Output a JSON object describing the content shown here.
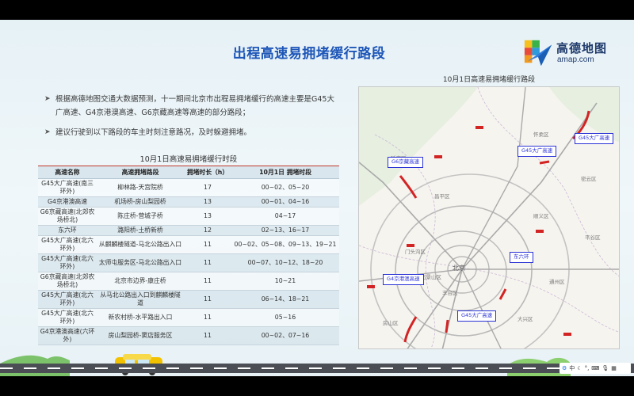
{
  "title": "出程高速易拥堵缓行路段",
  "logo": {
    "name": "高德地图",
    "sub": "amap.com"
  },
  "bullets": [
    "根据高德地图交通大数据预测，十一期间北京市出程易拥堵缓行的高速主要是G45大广高速、G4京港澳高速、G6京藏高速等高速的部分路段；",
    "建议行驶到以下路段的车主时刻注意路况，及时躲避拥堵。"
  ],
  "table": {
    "title": "10月1日高速易拥堵缓行时段",
    "headers": [
      "高速名称",
      "高速拥堵路段",
      "拥堵时长（h）",
      "10月1日 拥堵时段"
    ],
    "rows": [
      [
        "G45大广高速(南三环外)",
        "柳林路-天宫院桥",
        "17",
        "00~02、05~20"
      ],
      [
        "G4京港澳高速",
        "机场桥-房山梨园桥",
        "13",
        "00~01、04~16"
      ],
      [
        "G6京藏高速(北郊农场桥北)",
        "陈庄桥-营城子桥",
        "13",
        "04~17"
      ],
      [
        "东六环",
        "潞阳桥-土桥新桥",
        "12",
        "02~13、16~17"
      ],
      [
        "G45大广高速(北六环外)",
        "从麒麟楼隧道-马北公路出入口",
        "11",
        "00~02、05~08、09~13、19~21"
      ],
      [
        "G45大广高速(北六环外)",
        "太师屯服务区-马北公路出入口",
        "11",
        "00~07、10~12、18~20"
      ],
      [
        "G6京藏高速(北郊农场桥北)",
        "北京市边界-康庄桥",
        "11",
        "10~21"
      ],
      [
        "G45大广高速(北六环外)",
        "从马北公路出入口到麒麟楼隧道",
        "11",
        "06~14、18~21"
      ],
      [
        "G45大广高速(北六环外)",
        "新农村桥-水平路出入口",
        "11",
        "05~16"
      ],
      [
        "G4京港澳高速(六环外)",
        "房山梨园桥-窦店服务区",
        "11",
        "00~02、07~16"
      ]
    ]
  },
  "map": {
    "title": "10月1日高速易拥堵缓行路段",
    "badges": [
      "G45大广高速",
      "G45大广高速",
      "G6京藏高速",
      "东六环",
      "G4京港澳高速",
      "G45大广高速"
    ],
    "labels": [
      "北京",
      "怀柔区",
      "顺义区",
      "昌平区",
      "延庆区",
      "密云区",
      "通州区",
      "门头沟区",
      "房山区",
      "大兴区",
      "平谷区",
      "丰台区",
      "石景山区"
    ]
  },
  "taskbar": {
    "label": "中"
  },
  "colors": {
    "title": "#1d56b8",
    "congestion": "#d32424",
    "badge": "#2b33d6",
    "header_line": "#c0392b"
  }
}
